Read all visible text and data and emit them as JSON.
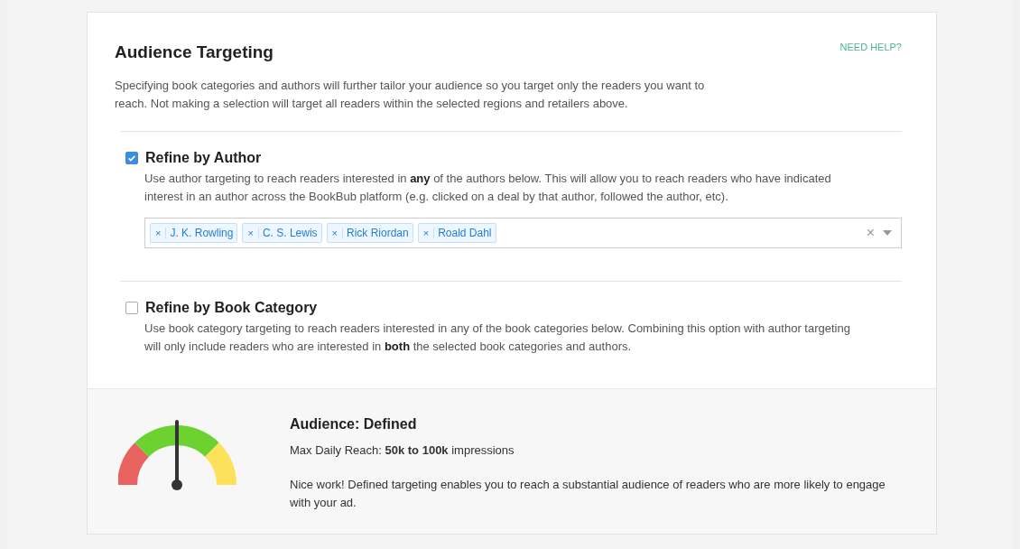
{
  "title": "Audience Targeting",
  "help_link": "NEED HELP?",
  "intro": "Specifying book categories and authors will further tailor your audience so you target only the readers you want to reach. Not making a selection will target all readers within the selected regions and retailers above.",
  "options": [
    {
      "kind": "tags",
      "label": "Refine by Author",
      "checked": true,
      "description": "Use author targeting to reach readers interested in **any** of the authors below. This will allow you to reach readers who have indicated interest in an author across the BookBub platform (e.g. clicked on a deal by that author, followed the author, etc).",
      "remove_mark": "×",
      "tags": [
        "J. K. Rowling",
        "C. S. Lewis",
        "Rick Riordan",
        "Roald Dahl"
      ],
      "clear_mark": "×"
    },
    {
      "kind": "plain",
      "label": "Refine by Book Category",
      "checked": false,
      "description": "Use book category targeting to reach readers interested in any of the book categories below. Combining this option with author targeting will only include readers who are interested in **both** the selected book categories and authors."
    }
  ],
  "summary": {
    "gauge": {
      "level": 0.5
    },
    "heading": "Audience: Defined",
    "reach": "Max Daily Reach: **50k to 100k** impressions",
    "message": "Nice work! Defined targeting enables you to reach a substantial audience of readers who are more likely to engage with your ad."
  }
}
